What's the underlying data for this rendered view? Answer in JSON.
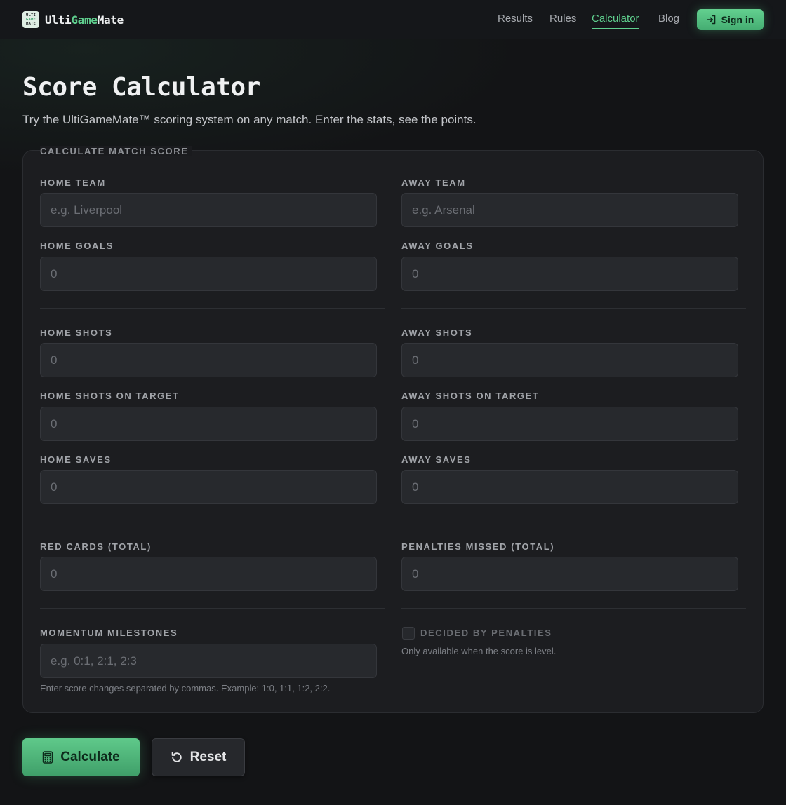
{
  "brand": {
    "mark_lines": [
      "ULTI",
      "GAME",
      "MATE"
    ],
    "name_prefix": "Ulti",
    "name_accent": "Game",
    "name_suffix": "Mate"
  },
  "nav": {
    "results": "Results",
    "rules": "Rules",
    "calculator": "Calculator",
    "blog": "Blog",
    "sign_in": "Sign in"
  },
  "page": {
    "title": "Score Calculator",
    "subtitle": "Try the UltiGameMate™ scoring system on any match. Enter the stats, see the points."
  },
  "form": {
    "legend": "CALCULATE MATCH SCORE",
    "home_team": {
      "label": "HOME TEAM",
      "placeholder": "e.g. Liverpool"
    },
    "away_team": {
      "label": "AWAY TEAM",
      "placeholder": "e.g. Arsenal"
    },
    "home_goals": {
      "label": "HOME GOALS",
      "placeholder": "0"
    },
    "away_goals": {
      "label": "AWAY GOALS",
      "placeholder": "0"
    },
    "home_shots": {
      "label": "HOME SHOTS",
      "placeholder": "0"
    },
    "away_shots": {
      "label": "AWAY SHOTS",
      "placeholder": "0"
    },
    "home_shots_on_target": {
      "label": "HOME SHOTS ON TARGET",
      "placeholder": "0"
    },
    "away_shots_on_target": {
      "label": "AWAY SHOTS ON TARGET",
      "placeholder": "0"
    },
    "home_saves": {
      "label": "HOME SAVES",
      "placeholder": "0"
    },
    "away_saves": {
      "label": "AWAY SAVES",
      "placeholder": "0"
    },
    "red_cards": {
      "label": "RED CARDS (TOTAL)",
      "placeholder": "0"
    },
    "penalties_missed": {
      "label": "PENALTIES MISSED (TOTAL)",
      "placeholder": "0"
    },
    "momentum": {
      "label": "MOMENTUM MILESTONES",
      "placeholder": "e.g. 0:1, 2:1, 2:3",
      "hint": "Enter score changes separated by commas. Example: 1:0, 1:1, 1:2, 2:2."
    },
    "decided_by_penalties": {
      "label": "DECIDED BY PENALTIES",
      "hint": "Only available when the score is level.",
      "checked": false
    }
  },
  "actions": {
    "calculate": "Calculate",
    "reset": "Reset"
  },
  "colors": {
    "accent": "#5fcf8e",
    "background": "#131416",
    "card": "#1c1d20",
    "input": "#27292d"
  }
}
